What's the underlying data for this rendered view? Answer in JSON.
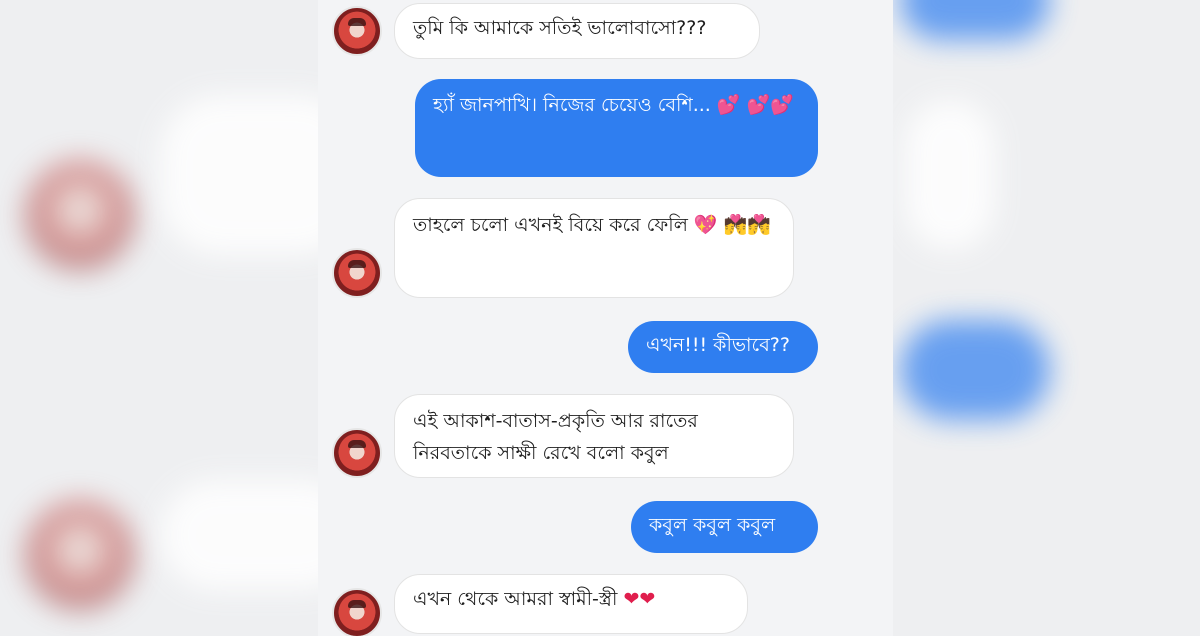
{
  "messages": [
    {
      "side": "in",
      "text": "তুমি কি আমাকে সতিই ভালোবাসো???",
      "emoji": ""
    },
    {
      "side": "out",
      "text": "হ্যাঁ জানপাখি। নিজের চেয়েও বেশি...",
      "emoji": "💕 💕💕"
    },
    {
      "side": "in",
      "text": "তাহলে চলো এখনই বিয়ে করে ফেলি",
      "emoji": "💖 💏💏"
    },
    {
      "side": "out",
      "text": "এখন!!! কীভাবে??",
      "emoji": ""
    },
    {
      "side": "in",
      "text": "এই আকাশ-বাতাস-প্রকৃতি আর রাতের নিরবতাকে সাক্ষী রেখে বলো কবুল",
      "emoji": ""
    },
    {
      "side": "out",
      "text": "কবুল কবুল কবুল",
      "emoji": ""
    },
    {
      "side": "in",
      "text": "এখন থেকে আমরা স্বামী-স্ত্রী",
      "emoji": "❤❤"
    }
  ],
  "colors": {
    "outgoing": "#2f7ef0",
    "incoming": "#ffffff",
    "background": "#f3f4f6"
  }
}
